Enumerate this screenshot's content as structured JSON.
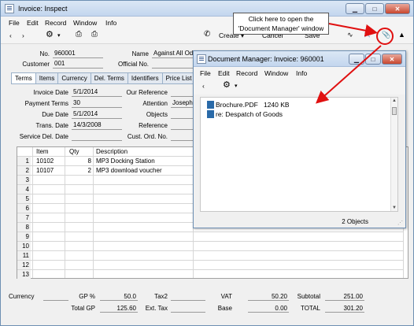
{
  "main": {
    "title": "Invoice: Inspect",
    "menu": [
      "File",
      "Edit",
      "Record",
      "Window",
      "Info"
    ],
    "toolbar": {
      "create": "Create",
      "cancel": "Cancel",
      "save": "Save"
    },
    "header": {
      "no_label": "No.",
      "no_value": "960001",
      "name_label": "Name",
      "name_value": "Against All Odds",
      "customer_label": "Customer",
      "customer_value": "001",
      "official_label": "Official No.",
      "official_value": ""
    },
    "tabs": [
      "Terms",
      "Items",
      "Currency",
      "Del. Terms",
      "Identifiers",
      "Price List"
    ],
    "terms": {
      "invoice_date_label": "Invoice Date",
      "invoice_date": "5/1/2014",
      "payment_terms_label": "Payment Terms",
      "payment_terms": "30",
      "due_date_label": "Due Date",
      "due_date": "5/1/2014",
      "trans_date_label": "Trans. Date",
      "trans_date": "14/3/2008",
      "service_del_label": "Service Del. Date",
      "service_del": "",
      "our_ref_label": "Our Reference",
      "our_ref": "",
      "attention_label": "Attention",
      "attention": "Joseph",
      "objects_label": "Objects",
      "objects": "",
      "reference_label": "Reference",
      "reference": "",
      "cust_ord_label": "Cust. Ord. No.",
      "cust_ord": ""
    },
    "grid": {
      "headers": {
        "item": "Item",
        "qty": "Qty",
        "description": "Description"
      },
      "rows": [
        {
          "n": "1",
          "item": "10102",
          "qty": "8",
          "description": "MP3 Docking Station"
        },
        {
          "n": "2",
          "item": "10107",
          "qty": "2",
          "description": "MP3 download voucher"
        },
        {
          "n": "3",
          "item": "",
          "qty": "",
          "description": ""
        },
        {
          "n": "4",
          "item": "",
          "qty": "",
          "description": ""
        },
        {
          "n": "5",
          "item": "",
          "qty": "",
          "description": ""
        },
        {
          "n": "6",
          "item": "",
          "qty": "",
          "description": ""
        },
        {
          "n": "7",
          "item": "",
          "qty": "",
          "description": ""
        },
        {
          "n": "8",
          "item": "",
          "qty": "",
          "description": ""
        },
        {
          "n": "9",
          "item": "",
          "qty": "",
          "description": ""
        },
        {
          "n": "10",
          "item": "",
          "qty": "",
          "description": ""
        },
        {
          "n": "11",
          "item": "",
          "qty": "",
          "description": ""
        },
        {
          "n": "12",
          "item": "",
          "qty": "",
          "description": ""
        },
        {
          "n": "13",
          "item": "",
          "qty": "",
          "description": ""
        }
      ]
    },
    "footer": {
      "currency_label": "Currency",
      "currency": "",
      "gp_pct_label": "GP %",
      "gp_pct": "50.0",
      "total_gp_label": "Total GP",
      "total_gp": "125.60",
      "tax2_label": "Tax2",
      "tax2": "",
      "ext_tax_label": "Ext. Tax",
      "ext_tax": "",
      "vat_label": "VAT",
      "vat": "50.20",
      "base_label": "Base",
      "base": "0.00",
      "subtotal_label": "Subtotal",
      "subtotal": "251.00",
      "total_label": "TOTAL",
      "total": "301.20"
    }
  },
  "docmanager": {
    "title": "Document Manager: Invoice: 960001",
    "menu": [
      "File",
      "Edit",
      "Record",
      "Window",
      "Info"
    ],
    "items": [
      {
        "name": "Brochure.PDF",
        "size": "1240 KB"
      },
      {
        "name": "re: Despatch of Goods",
        "size": ""
      }
    ],
    "status": "2 Objects"
  },
  "callout": {
    "line1": "Click here to open the",
    "line2": "'Document Manager' window"
  },
  "icons": {
    "doc_icon_color": "#2a6aa8",
    "highlight": "#e01010"
  }
}
